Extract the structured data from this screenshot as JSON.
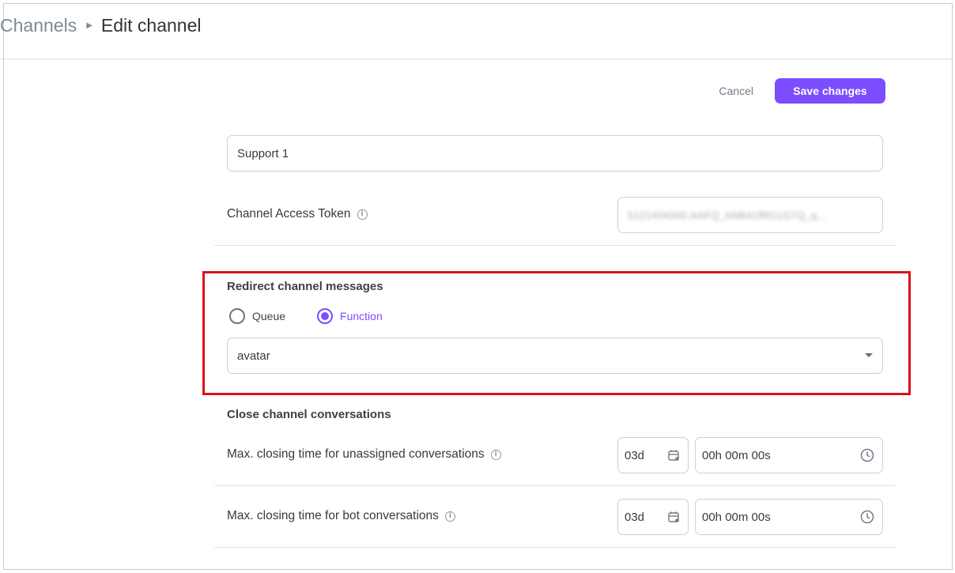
{
  "header": {
    "breadcrumb": {
      "parent": "Channels",
      "separator_icon": "caret-right-icon",
      "current": "Edit channel"
    }
  },
  "actions": {
    "cancel_label": "Cancel",
    "save_label": "Save changes"
  },
  "form": {
    "channel_name": {
      "value": "Support 1"
    },
    "access_token": {
      "label": "Channel Access Token",
      "info_icon": "info-icon",
      "value_masked": "5121434265:AAFQ_hNB41fRG1G7Q_q..."
    },
    "redirect": {
      "title": "Redirect channel messages",
      "options": [
        {
          "label": "Queue",
          "selected": false
        },
        {
          "label": "Function",
          "selected": true
        }
      ],
      "function_select": {
        "value": "avatar",
        "icon": "chevron-down-icon"
      }
    },
    "close_conversations": {
      "title": "Close channel conversations",
      "rows": [
        {
          "label": "Max. closing time for unassigned conversations",
          "days": "03d",
          "time": "00h 00m 00s"
        },
        {
          "label": "Max. closing time for bot conversations",
          "days": "03d",
          "time": "00h 00m 00s"
        }
      ]
    }
  },
  "colors": {
    "accent": "#7c4dff",
    "highlight": "#d9131b"
  }
}
